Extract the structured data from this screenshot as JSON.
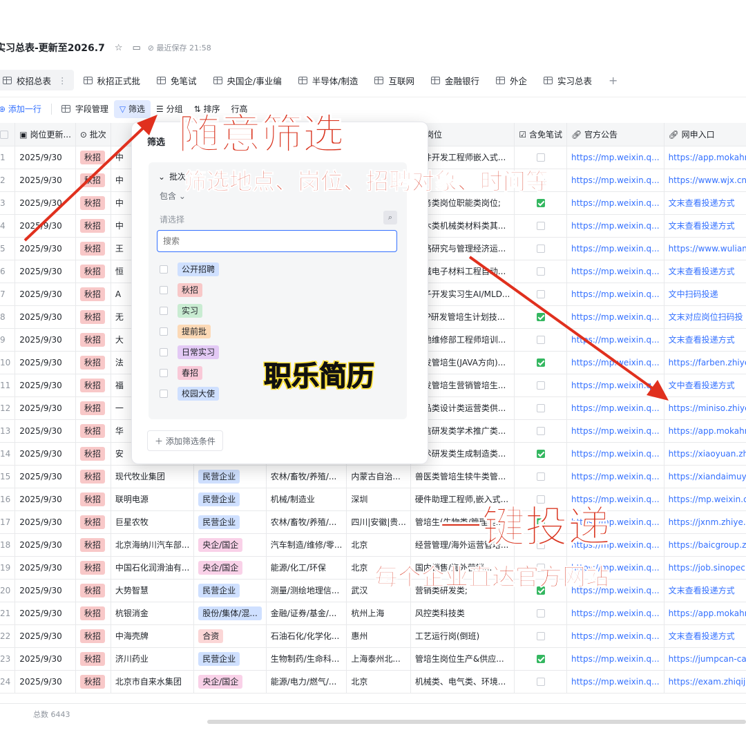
{
  "header": {
    "title": "实习总表-更新至2026.7",
    "saved": "最近保存 21:58"
  },
  "tabs": [
    {
      "label": "校招总表"
    },
    {
      "label": "秋招正式批"
    },
    {
      "label": "免笔试"
    },
    {
      "label": "央国企/事业编"
    },
    {
      "label": "半导体/制造"
    },
    {
      "label": "互联网"
    },
    {
      "label": "金融银行"
    },
    {
      "label": "外企"
    },
    {
      "label": "实习总表"
    }
  ],
  "toolbar": {
    "add_row": "添加一行",
    "fields": "字段管理",
    "filter": "筛选",
    "group": "分组",
    "sort": "排序",
    "row_height": "行高"
  },
  "columns": {
    "date": "岗位更新...",
    "batch": "批次",
    "position": "岗位",
    "written": "含免笔试",
    "notice": "官方公告",
    "apply": "网申入口"
  },
  "rows": [
    {
      "n": "1",
      "date": "2025/9/30",
      "batch": "秋招",
      "company": "中",
      "type": "",
      "industry": "",
      "loc": "",
      "pos": "硬件开发工程师嵌入式...",
      "w": false,
      "notice": "https://mp.weixin.q...",
      "apply": "https://app.mokahr..."
    },
    {
      "n": "2",
      "date": "2025/9/30",
      "batch": "秋招",
      "company": "中",
      "type": "",
      "industry": "",
      "loc": "",
      "pos": "",
      "w": false,
      "notice": "https://mp.weixin.q...",
      "apply": "https://www.wjx.cn/"
    },
    {
      "n": "3",
      "date": "2025/9/30",
      "batch": "秋招",
      "company": "中",
      "type": "",
      "industry": "",
      "loc": "",
      "pos": "业务类岗位职能类岗位;",
      "w": true,
      "notice": "https://mp.weixin.q...",
      "apply": "文末查看投递方式"
    },
    {
      "n": "4",
      "date": "2025/9/30",
      "batch": "秋招",
      "company": "中",
      "type": "",
      "industry": "",
      "loc": "",
      "pos": "土木类机械类材料类其...",
      "w": false,
      "notice": "https://mp.weixin.q...",
      "apply": "文末查看投递方式"
    },
    {
      "n": "5",
      "date": "2025/9/30",
      "batch": "秋招",
      "company": "王",
      "type": "",
      "industry": "",
      "loc": "",
      "pos": "战略研究与管理经济运...",
      "w": false,
      "notice": "https://mp.weixin.q...",
      "apply": "https://www.wuliang"
    },
    {
      "n": "6",
      "date": "2025/9/30",
      "batch": "秋招",
      "company": "恒",
      "type": "",
      "industry": "",
      "loc": "",
      "pos": "机械电子材料工程自动...",
      "w": false,
      "notice": "https://mp.weixin.q...",
      "apply": "文末查看投递方式"
    },
    {
      "n": "7",
      "date": "2025/9/30",
      "batch": "秋招",
      "company": "A",
      "type": "",
      "industry": "",
      "loc": "",
      "pos": "算子开发实习生AI/MLD...",
      "w": false,
      "notice": "https://mp.weixin.q...",
      "apply": "文中扫码投递"
    },
    {
      "n": "8",
      "date": "2025/9/30",
      "batch": "秋招",
      "company": "无",
      "type": "",
      "industry": "",
      "loc": "",
      "pos": "NLP研发管培生计划技...",
      "w": true,
      "notice": "https://mp.weixin.q...",
      "apply": "文末对应岗位扫码投"
    },
    {
      "n": "9",
      "date": "2025/9/30",
      "batch": "秋招",
      "company": "大",
      "type": "",
      "industry": "",
      "loc": "",
      "pos": "基地维修部工程师培训...",
      "w": false,
      "notice": "https://mp.weixin.q...",
      "apply": "文末查看投递方式"
    },
    {
      "n": "10",
      "date": "2025/9/30",
      "batch": "秋招",
      "company": "法",
      "type": "",
      "industry": "",
      "loc": "",
      "pos": "研发管培生(JAVA方向)...",
      "w": true,
      "notice": "https://mp.weixin.q...",
      "apply": "https://farben.zhiye"
    },
    {
      "n": "11",
      "date": "2025/9/30",
      "batch": "秋招",
      "company": "福",
      "type": "",
      "industry": "",
      "loc": "",
      "pos": "研发管培生营销管培生...",
      "w": false,
      "notice": "https://mp.weixin.q...",
      "apply": "文中查看投递方式"
    },
    {
      "n": "12",
      "date": "2025/9/30",
      "batch": "秋招",
      "company": "一",
      "type": "",
      "industry": "",
      "loc": "",
      "pos": "商品类设计类运营类供...",
      "w": false,
      "notice": "https://mp.weixin.q...",
      "apply": "https://miniso.zhiye"
    },
    {
      "n": "13",
      "date": "2025/9/30",
      "batch": "秋招",
      "company": "华",
      "type": "",
      "industry": "",
      "loc": "",
      "pos": "生信研发类学术推广类...",
      "w": false,
      "notice": "https://mp.weixin.q...",
      "apply": "https://app.mokahr."
    },
    {
      "n": "14",
      "date": "2025/9/30",
      "batch": "秋招",
      "company": "安",
      "type": "",
      "industry": "",
      "loc": "",
      "pos": "技术研发类生成制造类...",
      "w": true,
      "notice": "https://mp.weixin.q...",
      "apply": "https://xiaoyuan.zha"
    },
    {
      "n": "15",
      "date": "2025/9/30",
      "batch": "秋招",
      "company": "现代牧业集团",
      "type": "民营企业",
      "industry": "农林/畜牧/养殖/...",
      "loc": "内蒙古自治...",
      "pos": "兽医类管培生犊牛类管...",
      "w": false,
      "notice": "https://mp.weixin.q...",
      "apply": "https://xiandaimuye"
    },
    {
      "n": "16",
      "date": "2025/9/30",
      "batch": "秋招",
      "company": "联明电源",
      "type": "民营企业",
      "industry": "机械/制造业",
      "loc": "深圳",
      "pos": "硬件助理工程师,嵌入式...",
      "w": false,
      "notice": "https://mp.weixin.q...",
      "apply": "https://mp.weixin.qq"
    },
    {
      "n": "17",
      "date": "2025/9/30",
      "batch": "秋招",
      "company": "巨星农牧",
      "type": "民营企业",
      "industry": "农林/畜牧/养殖/...",
      "loc": "四川|安徽|贵...",
      "pos": "管培生(生物类/管理类...",
      "w": true,
      "notice": "https://mp.weixin.q...",
      "apply": "https://jxnm.zhiye.c"
    },
    {
      "n": "18",
      "date": "2025/9/30",
      "batch": "秋招",
      "company": "北京海纳川汽车部...",
      "type": "央企/国企",
      "industry": "汽车制造/维修/零...",
      "loc": "北京",
      "pos": "经营管理/海外运营管培...",
      "w": false,
      "notice": "https://mp.weixin.q...",
      "apply": "https://baicgroup.zh"
    },
    {
      "n": "19",
      "date": "2025/9/30",
      "batch": "秋招",
      "company": "中国石化润滑油有...",
      "type": "央企/国企",
      "industry": "能源/化工/环保",
      "loc": "北京",
      "pos": "国内销售/海外营销...",
      "w": false,
      "notice": "https://mp.weixin.q...",
      "apply": "https://job.sinopec.c"
    },
    {
      "n": "20",
      "date": "2025/9/30",
      "batch": "秋招",
      "company": "大势智慧",
      "type": "民营企业",
      "industry": "测量/测绘地理信...",
      "loc": "武汉",
      "pos": "营销类研发类;",
      "w": true,
      "notice": "https://mp.weixin.q...",
      "apply": "文末查看投递方式"
    },
    {
      "n": "21",
      "date": "2025/9/30",
      "batch": "秋招",
      "company": "杭银消金",
      "type": "股份/集体/混...",
      "industry": "金融/证券/基金/...",
      "loc": "杭州上海",
      "pos": "风控类科技类",
      "w": false,
      "notice": "https://mp.weixin.q...",
      "apply": "https://app.mokahr."
    },
    {
      "n": "22",
      "date": "2025/9/30",
      "batch": "秋招",
      "company": "中海壳牌",
      "type": "合资",
      "industry": "石油石化/化学化...",
      "loc": "惠州",
      "pos": "工艺运行岗(倒班)",
      "w": false,
      "notice": "https://mp.weixin.q...",
      "apply": "文末查看投递方式"
    },
    {
      "n": "23",
      "date": "2025/9/30",
      "batch": "秋招",
      "company": "济川药业",
      "type": "民营企业",
      "industry": "生物制药/生命科...",
      "loc": "上海泰州北...",
      "pos": "管培生岗位生产&供应...",
      "w": true,
      "notice": "https://mp.weixin.q...",
      "apply": "https://jumpcan-car"
    },
    {
      "n": "24",
      "date": "2025/9/30",
      "batch": "秋招",
      "company": "北京市自来水集团",
      "type": "央企/国企",
      "industry": "能源/电力/燃气/...",
      "loc": "北京",
      "pos": "机械类、电气类、环境...",
      "w": false,
      "notice": "https://mp.weixin.q...",
      "apply": "https://exam.zhiqiji"
    }
  ],
  "footer": {
    "total": "总数 6443"
  },
  "filter_panel": {
    "title": "筛选",
    "field": "批次",
    "operator": "包含",
    "select_placeholder": "请选择",
    "search_placeholder": "搜索",
    "add_condition": "添加筛选条件",
    "options": [
      {
        "label": "公开招聘",
        "color": "#cfe0ff"
      },
      {
        "label": "秋招",
        "color": "#f8c8c8"
      },
      {
        "label": "实习",
        "color": "#c9ecd2"
      },
      {
        "label": "提前批",
        "color": "#fcd9b6"
      },
      {
        "label": "日常实习",
        "color": "#e3c9f5"
      },
      {
        "label": "春招",
        "color": "#f9c9d8"
      },
      {
        "label": "校园大使",
        "color": "#cfe0ff"
      }
    ]
  },
  "annotations": {
    "headline1": "随意筛选",
    "sub1": "筛选地点、岗位、招聘对象、时间等",
    "brand": "职乐简历",
    "headline2": "一键投递",
    "sub2": "每个企业直达官方网站"
  },
  "colors": {
    "accent": "#3370ff",
    "annotation_red": "#d9341f",
    "check_green": "#34b760"
  }
}
